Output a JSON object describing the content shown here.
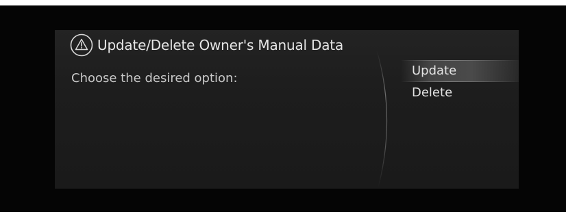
{
  "dialog": {
    "icon": "warning-triangle-icon",
    "title": "Update/Delete Owner's Manual Data",
    "message": "Choose the desired option:"
  },
  "options": [
    {
      "label": "Update",
      "selected": true
    },
    {
      "label": "Delete",
      "selected": false
    }
  ],
  "colors": {
    "screen_background": "#050505",
    "dialog_background": "#1e1e1e",
    "text": "#e6e6e6",
    "highlight": "#4a4a4a"
  }
}
